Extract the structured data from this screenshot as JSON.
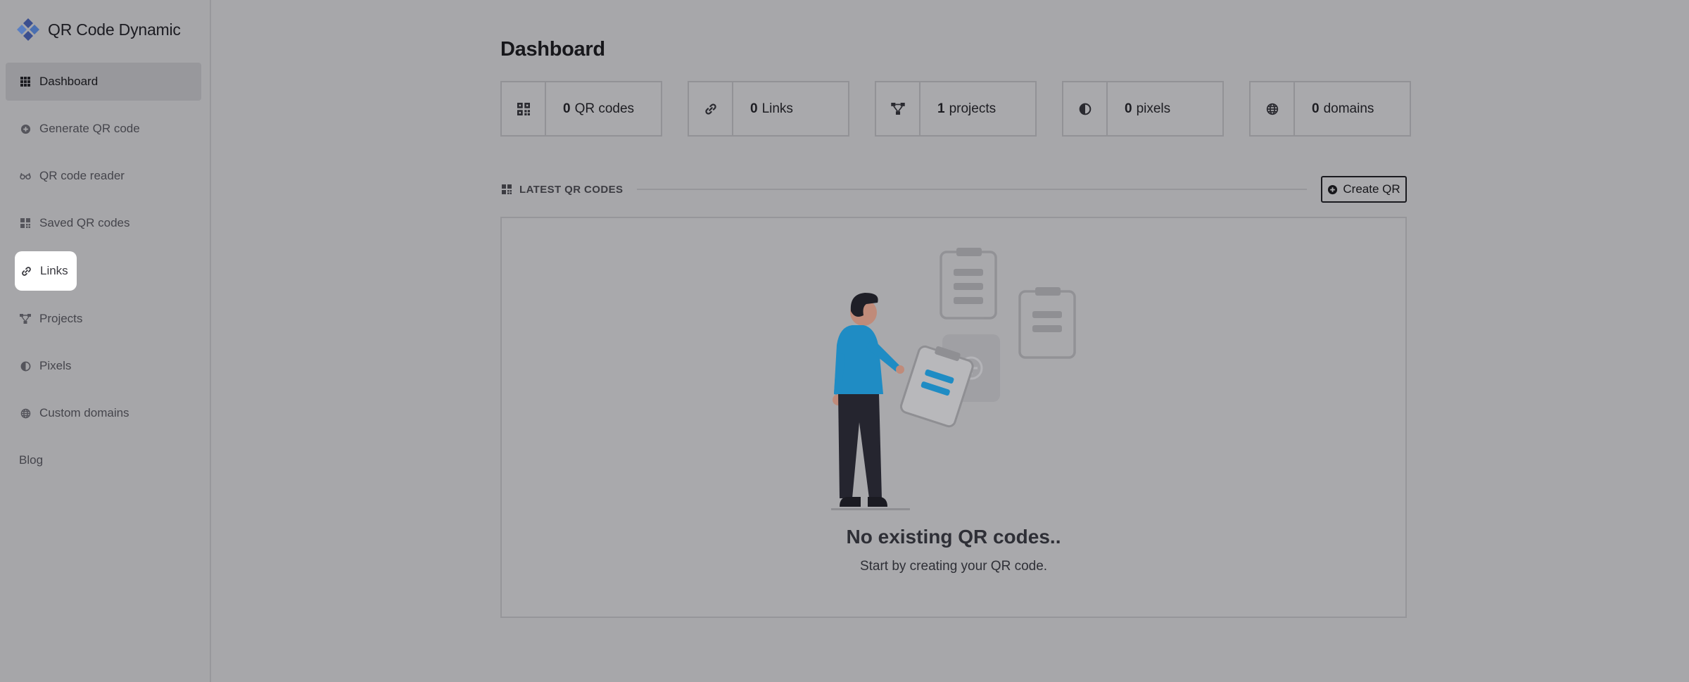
{
  "app": {
    "name": "QR Code Dynamic"
  },
  "sidebar": {
    "items": [
      {
        "label": "Dashboard",
        "icon": "grid-icon",
        "active": true
      },
      {
        "label": "Generate QR code",
        "icon": "plus-circle-icon"
      },
      {
        "label": "QR code reader",
        "icon": "glasses-icon"
      },
      {
        "label": "Saved QR codes",
        "icon": "qr-icon"
      },
      {
        "label": "Links",
        "icon": "link-icon",
        "highlighted": true
      },
      {
        "label": "Projects",
        "icon": "project-icon"
      },
      {
        "label": "Pixels",
        "icon": "half-circle-icon"
      },
      {
        "label": "Custom domains",
        "icon": "globe-icon"
      },
      {
        "label": "Blog"
      }
    ]
  },
  "main": {
    "title": "Dashboard",
    "stats": [
      {
        "count": "0",
        "label": "QR codes",
        "icon": "qr-icon"
      },
      {
        "count": "0",
        "label": "Links",
        "icon": "link-icon"
      },
      {
        "count": "1",
        "label": "projects",
        "icon": "project-icon"
      },
      {
        "count": "0",
        "label": "pixels",
        "icon": "half-circle-icon"
      },
      {
        "count": "0",
        "label": "domains",
        "icon": "globe-icon"
      }
    ],
    "latest": {
      "title": "LATEST QR CODES",
      "create_label": "Create QR",
      "empty_title": "No existing QR codes..",
      "empty_subtitle": "Start by creating your QR code."
    }
  },
  "colors": {
    "overlay": "#a7a7aa",
    "accent": "#1f8cc4",
    "highlight": "#ffffff"
  }
}
